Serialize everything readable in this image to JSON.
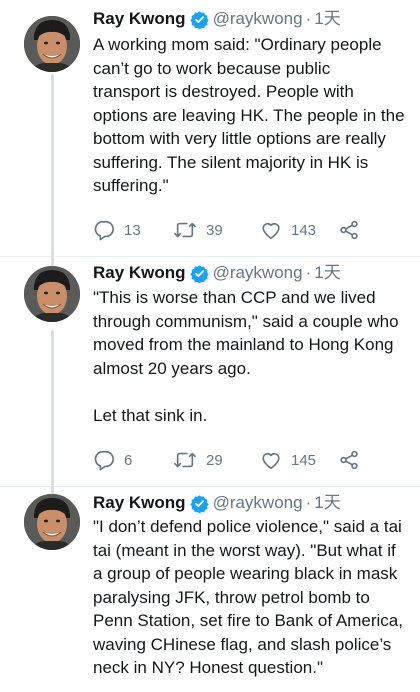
{
  "tweets": [
    {
      "author_name": "Ray Kwong",
      "handle": "@raykwong",
      "separator": "·",
      "time": "1天",
      "text": "A working mom said: \"Ordinary people\ncan’t go to work because public\ntransport is destroyed. People with\noptions are leaving HK. The people in the\nbottom with very little options are really\nsuffering. The silent majority in HK is\nsuffering.\"",
      "replies": "13",
      "retweets": "39",
      "likes": "143"
    },
    {
      "author_name": "Ray Kwong",
      "handle": "@raykwong",
      "separator": "·",
      "time": "1天",
      "text": "\"This is worse than CCP and we lived\nthrough communism,\" said a couple who\nmoved from the mainland to Hong Kong\nalmost 20 years ago.\n\nLet that sink in.",
      "replies": "6",
      "retweets": "29",
      "likes": "145"
    },
    {
      "author_name": "Ray Kwong",
      "handle": "@raykwong",
      "separator": "·",
      "time": "1天",
      "text": "\"I don’t defend police violence,\" said a tai\ntai (meant in the worst way). \"But what if\na group of people wearing black in mask\nparalysing JFK, throw petrol bomb to\nPenn Station, set fire to Bank of America,\nwaving CHinese flag, and slash police’s\nneck in NY? Honest question.\""
    }
  ],
  "icons": {
    "verified_color": "#1da1f2",
    "action_color": "#657786"
  }
}
